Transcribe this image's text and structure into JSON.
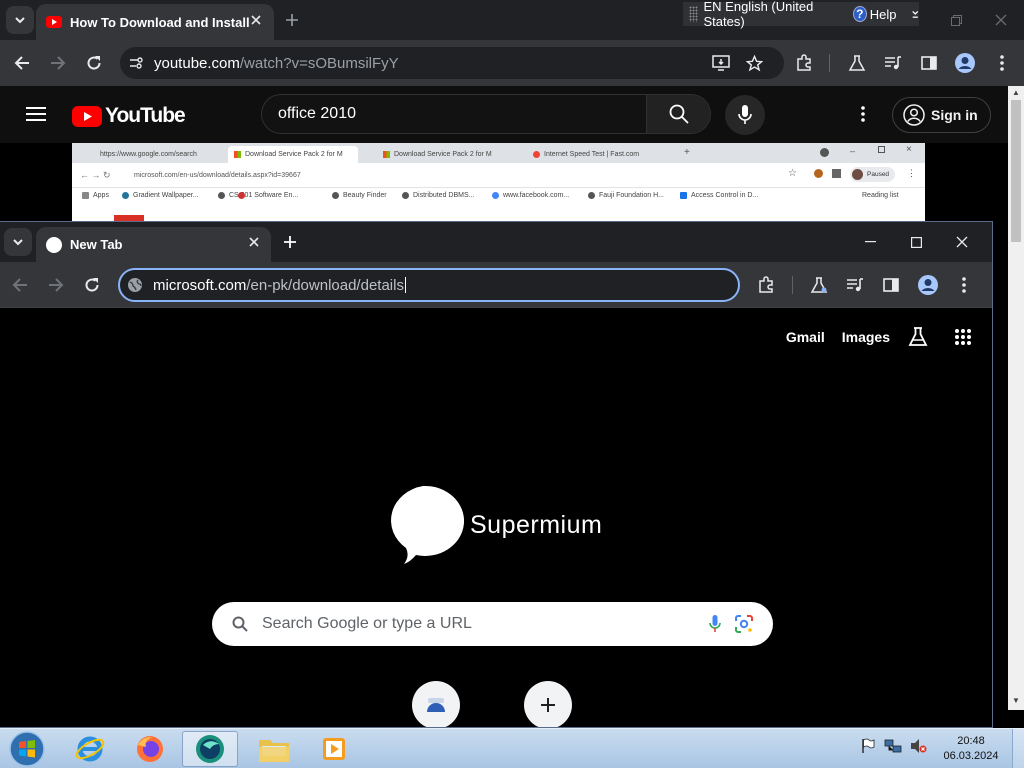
{
  "back_browser": {
    "tab_title": "How To Download and Install |",
    "url_host": "youtube.com",
    "url_path": "/watch?v=sOBumsilFyY"
  },
  "language_bar": {
    "language": "EN English (United States)",
    "help": "Help"
  },
  "youtube": {
    "logo_text": "YouTube",
    "search_query": "office 2010",
    "sign_in": "Sign in"
  },
  "video_frame": {
    "tabs": [
      "https://www.google.com/search",
      "Download Service Pack 2 for M",
      "Download Service Pack 2 for M",
      "Internet Speed Test | Fast.com"
    ],
    "url": "microsoft.com/en-us/download/details.aspx?id=39667",
    "paused": "Paused",
    "bookmarks": [
      "Apps",
      "Gradient Wallpaper...",
      "CS 501 Software En...",
      "Beauty Finder",
      "Distributed DBMS...",
      "www.facebook.com...",
      "Fauji Foundation H...",
      "Access Control in D..."
    ],
    "reading_list": "Reading list"
  },
  "front_browser": {
    "tab_title": "New Tab",
    "url_host": "microsoft.com",
    "url_path": "/en-pk/download/details",
    "ntp": {
      "gmail": "Gmail",
      "images": "Images",
      "brand": "Supermium",
      "search_placeholder": "Search Google or type a URL"
    }
  },
  "taskbar": {
    "time": "20:48",
    "date": "06.03.2024"
  }
}
